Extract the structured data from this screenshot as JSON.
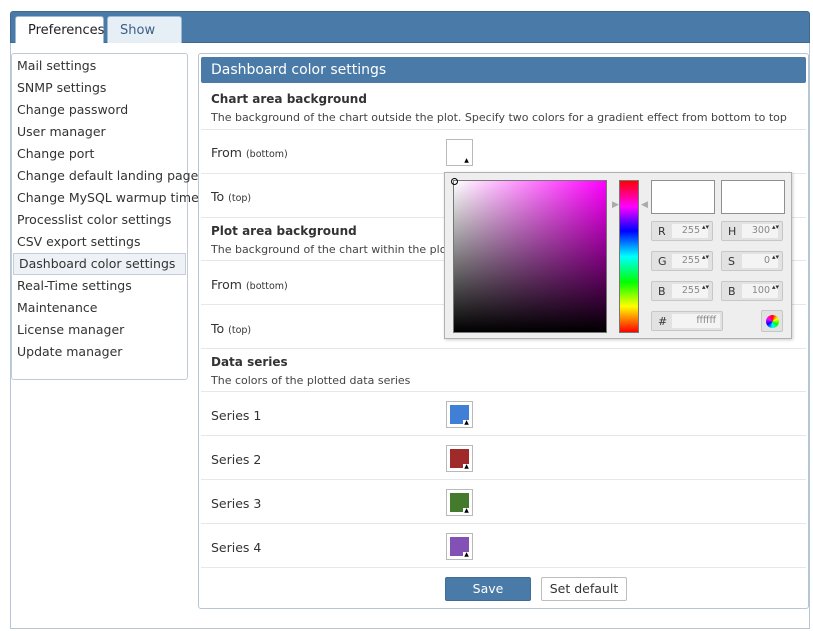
{
  "tabs": [
    {
      "label": "Preferences",
      "active": true
    },
    {
      "label": "Show Log",
      "active": false
    }
  ],
  "sidebar": {
    "items": [
      {
        "label": "Mail settings"
      },
      {
        "label": "SNMP settings"
      },
      {
        "label": "Change password"
      },
      {
        "label": "User manager"
      },
      {
        "label": "Change port"
      },
      {
        "label": "Change default landing page"
      },
      {
        "label": "Change MySQL warmup time"
      },
      {
        "label": "Processlist color settings"
      },
      {
        "label": "CSV export settings"
      },
      {
        "label": "Dashboard color settings",
        "selected": true
      },
      {
        "label": "Real-Time settings"
      },
      {
        "label": "Maintenance"
      },
      {
        "label": "License manager"
      },
      {
        "label": "Update manager"
      }
    ]
  },
  "panel": {
    "title": "Dashboard color settings",
    "chart_area": {
      "title": "Chart area background",
      "desc": "The background of the chart outside the plot. Specify two colors for a gradient effect from bottom to top",
      "from_label": "From",
      "from_hint": "(bottom)",
      "from_color": "#ffffff",
      "to_label": "To",
      "to_hint": "(top)",
      "to_color": "#ffffff"
    },
    "plot_area": {
      "title": "Plot area background",
      "desc": "The background of the chart within the plot area",
      "from_label": "From",
      "from_hint": "(bottom)",
      "to_label": "To",
      "to_hint": "(top)"
    },
    "data_series": {
      "title": "Data series",
      "desc": "The colors of the plotted data series",
      "series": [
        {
          "label": "Series 1",
          "color": "#3f80d6"
        },
        {
          "label": "Series 2",
          "color": "#a02a2a"
        },
        {
          "label": "Series 3",
          "color": "#437a2b"
        },
        {
          "label": "Series 4",
          "color": "#8350b5"
        }
      ]
    },
    "buttons": {
      "save": "Save",
      "set_default": "Set default"
    }
  },
  "picker": {
    "r_label": "R",
    "r_value": "255",
    "g_label": "G",
    "g_value": "255",
    "b_label": "B",
    "b_value": "255",
    "h_label": "H",
    "h_value": "300",
    "s_label": "S",
    "s_value": "0",
    "v_label": "B",
    "v_value": "100",
    "hex_label": "#",
    "hex_value": "ffffff",
    "spin_glyph": "▴▾"
  }
}
